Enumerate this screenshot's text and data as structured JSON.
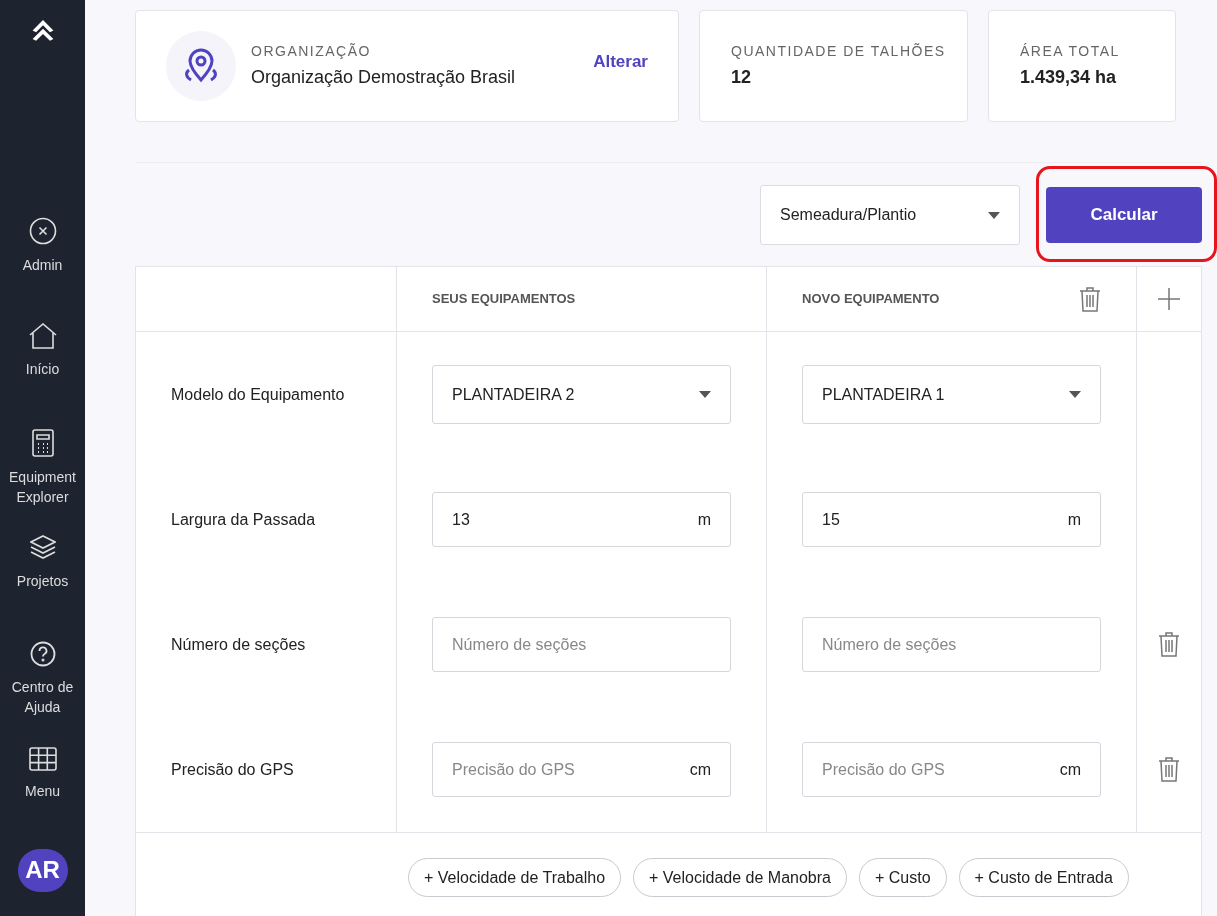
{
  "sidebar": {
    "items": [
      {
        "label": "Admin"
      },
      {
        "label": "Início"
      },
      {
        "label": "Equipment Explorer"
      },
      {
        "label": "Projetos"
      },
      {
        "label": "Centro de Ajuda"
      },
      {
        "label": "Menu"
      }
    ],
    "avatar": "AR"
  },
  "organization": {
    "label": "ORGANIZAÇÃO",
    "name": "Organização Demostração Brasil",
    "action": "Alterar"
  },
  "stats": [
    {
      "label": "QUANTIDADE DE TALHÕES",
      "value": "12"
    },
    {
      "label": "ÁREA TOTAL",
      "value": "1.439,34 ha"
    }
  ],
  "operation": {
    "value": "Semeadura/Plantio"
  },
  "calculate_button": "Calcular",
  "table": {
    "columns": [
      "SEUS EQUIPAMENTOS",
      "NOVO EQUIPAMENTO"
    ],
    "rows": [
      {
        "label": "Modelo do Equipamento",
        "kind": "select",
        "deletable": false,
        "cells": [
          {
            "value": "PLANTADEIRA 2"
          },
          {
            "value": "PLANTADEIRA 1"
          }
        ]
      },
      {
        "label": "Largura da Passada",
        "kind": "input",
        "deletable": false,
        "cells": [
          {
            "value": "13",
            "unit": "m"
          },
          {
            "value": "15",
            "unit": "m"
          }
        ]
      },
      {
        "label": "Número de seções",
        "kind": "input",
        "deletable": true,
        "cells": [
          {
            "placeholder": "Número de seções"
          },
          {
            "placeholder": "Número de seções"
          }
        ]
      },
      {
        "label": "Precisão do GPS",
        "kind": "input",
        "deletable": true,
        "cells": [
          {
            "placeholder": "Precisão do GPS",
            "unit": "cm"
          },
          {
            "placeholder": "Precisão do GPS",
            "unit": "cm"
          }
        ]
      }
    ],
    "add_buttons": [
      "+ Velocidade de Trabalho",
      "+ Velocidade de Manobra",
      "+ Custo",
      "+ Custo de Entrada"
    ]
  }
}
